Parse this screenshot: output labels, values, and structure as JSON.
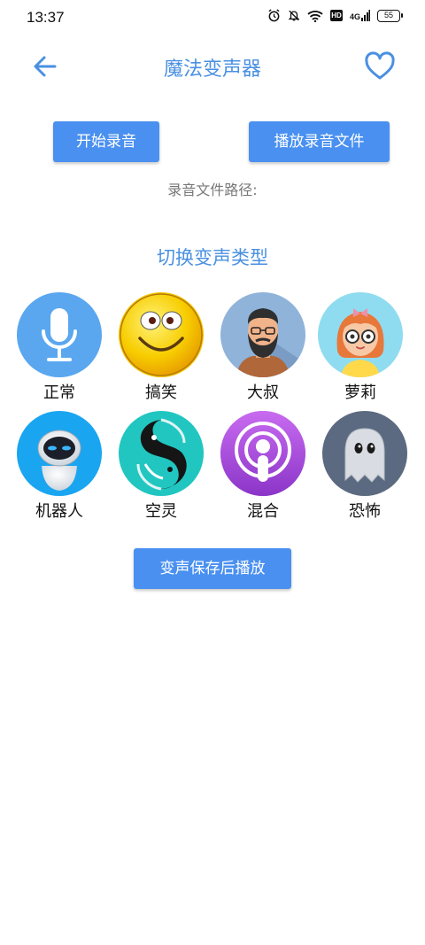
{
  "status": {
    "time": "13:37",
    "network": "4G",
    "battery": "55",
    "hd": "HD"
  },
  "header": {
    "title": "魔法变声器",
    "back_icon": "arrow-left-icon",
    "favorite_icon": "heart-outline-icon"
  },
  "actions": {
    "record_label": "开始录音",
    "play_label": "播放录音文件",
    "save_label": "变声保存后播放"
  },
  "path_label": "录音文件路径:",
  "section_title": "切换变声类型",
  "voices": [
    {
      "label": "正常",
      "icon": "microphone-icon",
      "color": "#5aa7f0"
    },
    {
      "label": "搞笑",
      "icon": "funny-emoji-icon",
      "color": "#f5c400"
    },
    {
      "label": "大叔",
      "icon": "uncle-avatar-icon",
      "color": "#8fb3d9"
    },
    {
      "label": "萝莉",
      "icon": "girl-avatar-icon",
      "color": "#8fdcf0"
    },
    {
      "label": "机器人",
      "icon": "robot-icon",
      "color": "#1aa5f0"
    },
    {
      "label": "空灵",
      "icon": "yin-yang-fish-icon",
      "color": "#21c6c0"
    },
    {
      "label": "混合",
      "icon": "podcast-icon",
      "color": "#a64fdc"
    },
    {
      "label": "恐怖",
      "icon": "ghost-icon",
      "color": "#5b6a80"
    }
  ],
  "colors": {
    "accent": "#4a90e2",
    "button": "#4a90f0"
  }
}
